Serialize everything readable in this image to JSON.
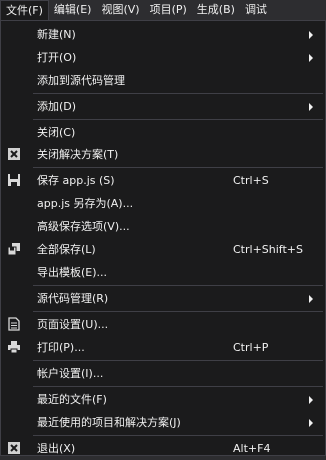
{
  "menubar": [
    "文件(F)",
    "编辑(E)",
    "视图(V)",
    "项目(P)",
    "生成(B)",
    "调试"
  ],
  "menu": {
    "new": "新建(N)",
    "open": "打开(O)",
    "add_source_control": "添加到源代码管理",
    "add": "添加(D)",
    "close": "关闭(C)",
    "close_solution": "关闭解决方案(T)",
    "save": "保存 app.js (S)",
    "save_sc": "Ctrl+S",
    "save_as": "app.js 另存为(A)...",
    "advanced_save": "高级保存选项(V)...",
    "save_all": "全部保存(L)",
    "save_all_sc": "Ctrl+Shift+S",
    "export_template": "导出模板(E)...",
    "source_control": "源代码管理(R)",
    "page_setup": "页面设置(U)...",
    "print": "打印(P)...",
    "print_sc": "Ctrl+P",
    "account_settings": "帐户设置(I)...",
    "recent_files": "最近的文件(F)",
    "recent_projects": "最近使用的项目和解决方案(J)",
    "exit": "退出(X)",
    "exit_sc": "Alt+F4"
  },
  "icons": {
    "close_solution": "close-x-icon",
    "save": "floppy-disk-icon",
    "save_all": "save-all-icon",
    "page_setup": "page-setup-icon",
    "print": "printer-icon",
    "exit": "close-x-icon"
  }
}
